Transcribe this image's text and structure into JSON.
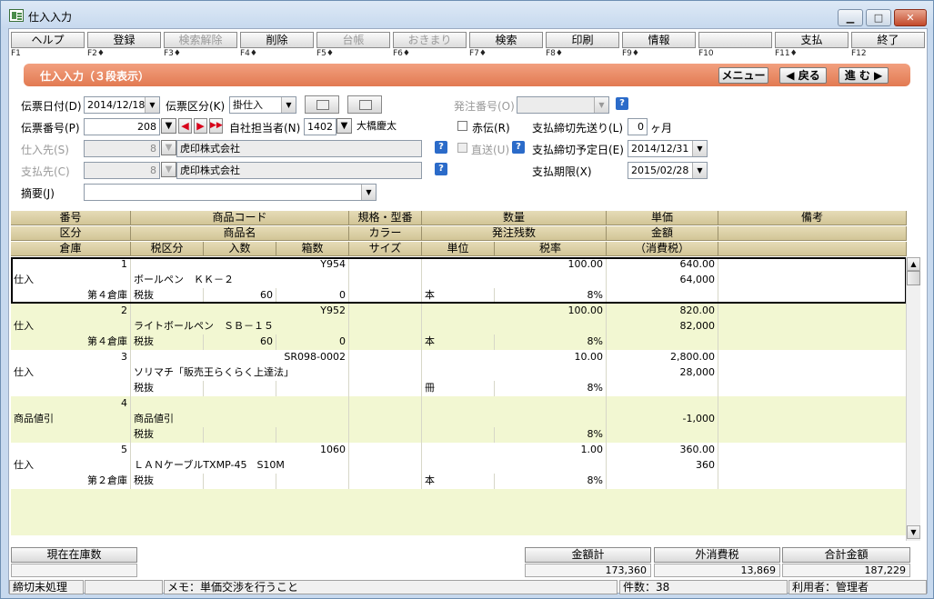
{
  "window": {
    "title": "仕入入力",
    "min": "▁",
    "max": "□",
    "close": "✕"
  },
  "fkeys": [
    {
      "label": "ヘルプ",
      "key": "F1",
      "disabled": false
    },
    {
      "label": "登録",
      "key": "F2♦",
      "disabled": false
    },
    {
      "label": "検索解除",
      "key": "F3♦",
      "disabled": true
    },
    {
      "label": "削除",
      "key": "F4♦",
      "disabled": false
    },
    {
      "label": "台帳",
      "key": "F5♦",
      "disabled": true
    },
    {
      "label": "おきまり",
      "key": "F6♦",
      "disabled": true
    },
    {
      "label": "検索",
      "key": "F7♦",
      "disabled": false
    },
    {
      "label": "印刷",
      "key": "F8♦",
      "disabled": false
    },
    {
      "label": "情報",
      "key": "F9♦",
      "disabled": false
    },
    {
      "label": "",
      "key": "F10",
      "disabled": false
    },
    {
      "label": "支払",
      "key": "F11♦",
      "disabled": false
    },
    {
      "label": "終了",
      "key": "F12",
      "disabled": false
    }
  ],
  "header": {
    "title": "仕入入力（３段表示）",
    "menu": "メニュー",
    "back": "◀ 戻る",
    "next": "進 む ▶"
  },
  "form": {
    "denpyo_date_label": "伝票日付(D)",
    "denpyo_date": "2014/12/18",
    "denpyo_kubun_label": "伝票区分(K)",
    "denpyo_kubun": "掛仕入",
    "denpyo_no_label": "伝票番号(P)",
    "denpyo_no": "208",
    "tanto_label": "自社担当者(N)",
    "tanto_code": "1402",
    "tanto_name": "大橋慶太",
    "shiiresaki_label": "仕入先(S)",
    "shiiresaki_code": "8",
    "shiiresaki_name": "虎印株式会社",
    "shiharaisaki_label": "支払先(C)",
    "shiharaisaki_code": "8",
    "shiharaisaki_name": "虎印株式会社",
    "tekiyo_label": "摘要(J)",
    "tekiyo": "",
    "hacchu_label": "発注番号(O)",
    "hacchu_no": "",
    "akaden_label": "赤伝(R)",
    "chokuso_label": "直送(U)",
    "shimekiri_label": "支払締切先送り(L)",
    "shimekiri_value": "0",
    "shimekiri_unit": "ヶ月",
    "yotei_label": "支払締切予定日(E)",
    "yotei_date": "2014/12/31",
    "kigen_label": "支払期限(X)",
    "kigen_date": "2015/02/28"
  },
  "grid_headers": {
    "r1": [
      "番号",
      "商品コード",
      "規格・型番",
      "数量",
      "単価",
      "備考"
    ],
    "r2": [
      "区分",
      "商品名",
      "カラー",
      "発注残数",
      "金額",
      ""
    ],
    "r3": [
      "倉庫",
      "税区分",
      "入数",
      "箱数",
      "サイズ",
      "単位",
      "税率",
      "（消費税）",
      ""
    ]
  },
  "rows": [
    {
      "no": "1",
      "code": "Y954",
      "qty": "100.00",
      "price": "640.00",
      "kubun": "仕入",
      "name": "ボールペン　ＫＫ－２",
      "amount": "64,000",
      "soko": "第４倉庫",
      "zei": "税抜",
      "irisu": "60",
      "hakosu": "0",
      "tani": "本",
      "rate": "8%"
    },
    {
      "no": "2",
      "code": "Y952",
      "qty": "100.00",
      "price": "820.00",
      "kubun": "仕入",
      "name": "ライトボールペン　ＳＢ－１５",
      "amount": "82,000",
      "soko": "第４倉庫",
      "zei": "税抜",
      "irisu": "60",
      "hakosu": "0",
      "tani": "本",
      "rate": "8%"
    },
    {
      "no": "3",
      "code": "SR098-0002",
      "qty": "10.00",
      "price": "2,800.00",
      "kubun": "仕入",
      "name": "ソリマチ「販売王らくらく上達法」",
      "amount": "28,000",
      "soko": "",
      "zei": "税抜",
      "irisu": "",
      "hakosu": "",
      "tani": "冊",
      "rate": "8%"
    },
    {
      "no": "4",
      "code": "",
      "qty": "",
      "price": "",
      "kubun": "商品値引",
      "name": "商品値引",
      "amount": "-1,000",
      "soko": "",
      "zei": "税抜",
      "irisu": "",
      "hakosu": "",
      "tani": "",
      "rate": "8%"
    },
    {
      "no": "5",
      "code": "1060",
      "qty": "1.00",
      "price": "360.00",
      "kubun": "仕入",
      "name": "ＬＡＮケーブルTXMP-45　S10M",
      "amount": "360",
      "soko": "第２倉庫",
      "zei": "税抜",
      "irisu": "",
      "hakosu": "",
      "tani": "本",
      "rate": "8%"
    }
  ],
  "bottom": {
    "zaiko_label": "現在在庫数",
    "kingaku_label": "金額計",
    "kingaku": "173,360",
    "sotozei_label": "外消費税",
    "sotozei": "13,869",
    "gokei_label": "合計金額",
    "gokei": "187,229"
  },
  "status": {
    "shimekiri": "締切未処理",
    "memo": "メモ：単価交渉を行うこと",
    "count": "件数：38",
    "user": "利用者：管理者"
  }
}
